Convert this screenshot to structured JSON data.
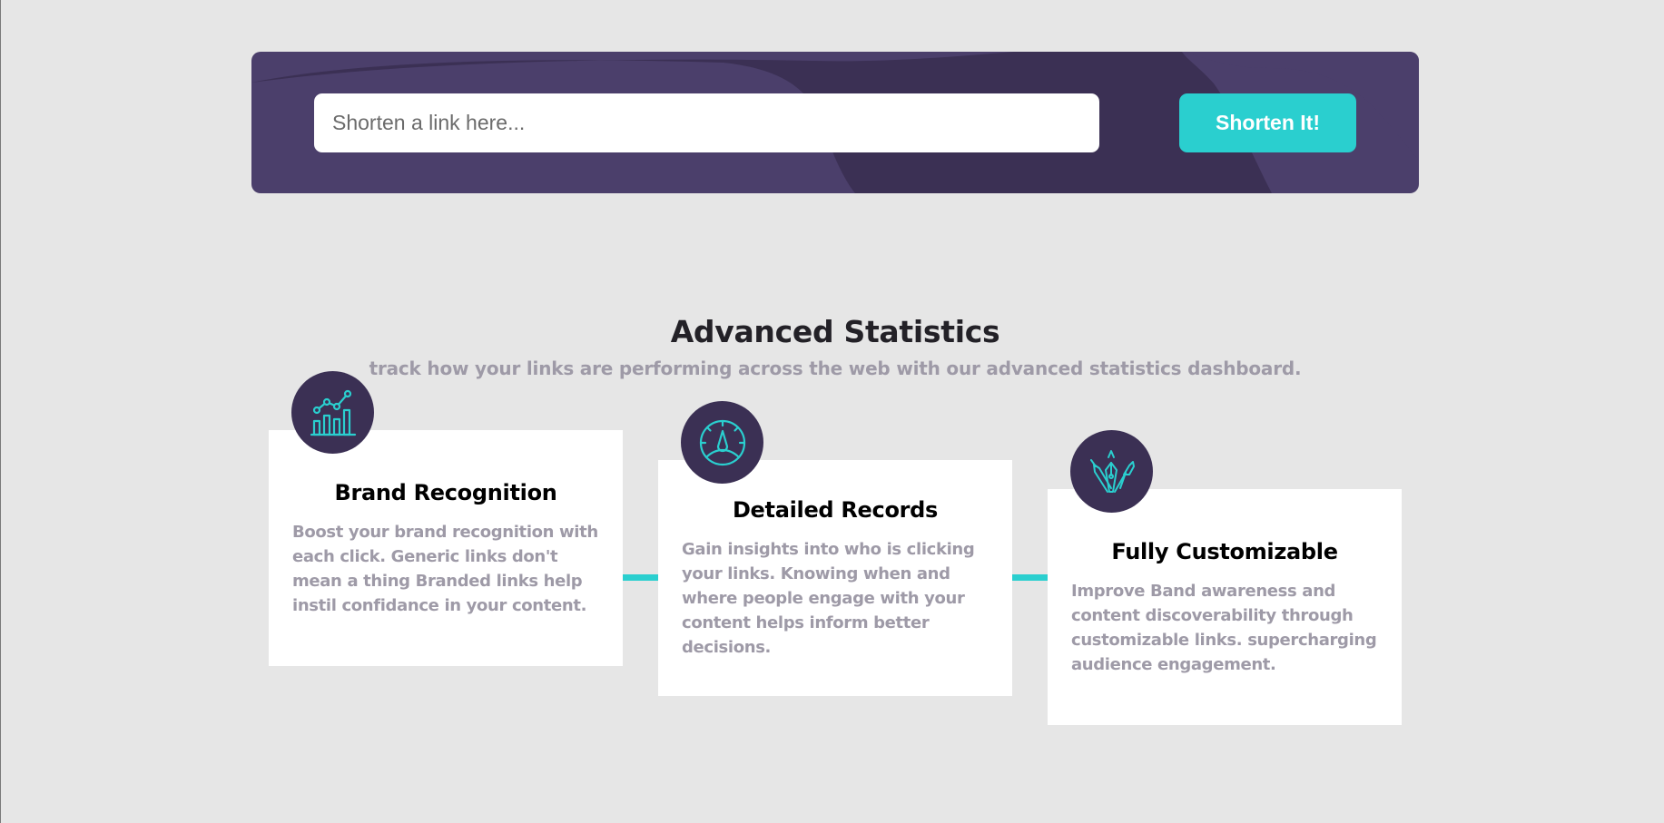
{
  "shorten": {
    "placeholder": "Shorten a link here...",
    "button_label": "Shorten It!"
  },
  "statistics": {
    "title": "Advanced Statistics",
    "subtitle": "track how your links are performing across the web with our advanced statistics dashboard.",
    "cards": [
      {
        "icon": "brand-recognition-icon",
        "title": "Brand Recognition",
        "text": "Boost your brand recognition with each click. Generic links don't mean a thing Branded links help instil confidance in your content."
      },
      {
        "icon": "detailed-records-icon",
        "title": "Detailed Records",
        "text": "Gain insights into who is clicking your links. Knowing when and where people engage with your content helps inform better decisions."
      },
      {
        "icon": "fully-customizable-icon",
        "title": "Fully Customizable",
        "text": "Improve Band awareness and content discoverability through customizable links. supercharging audience engagement."
      }
    ]
  },
  "colors": {
    "page_background": "#e6e6e6",
    "banner_background": "#4b3f6b",
    "accent_cyan": "#2acfcf",
    "icon_circle": "#3b3054",
    "muted_text": "#9e9aa7"
  }
}
